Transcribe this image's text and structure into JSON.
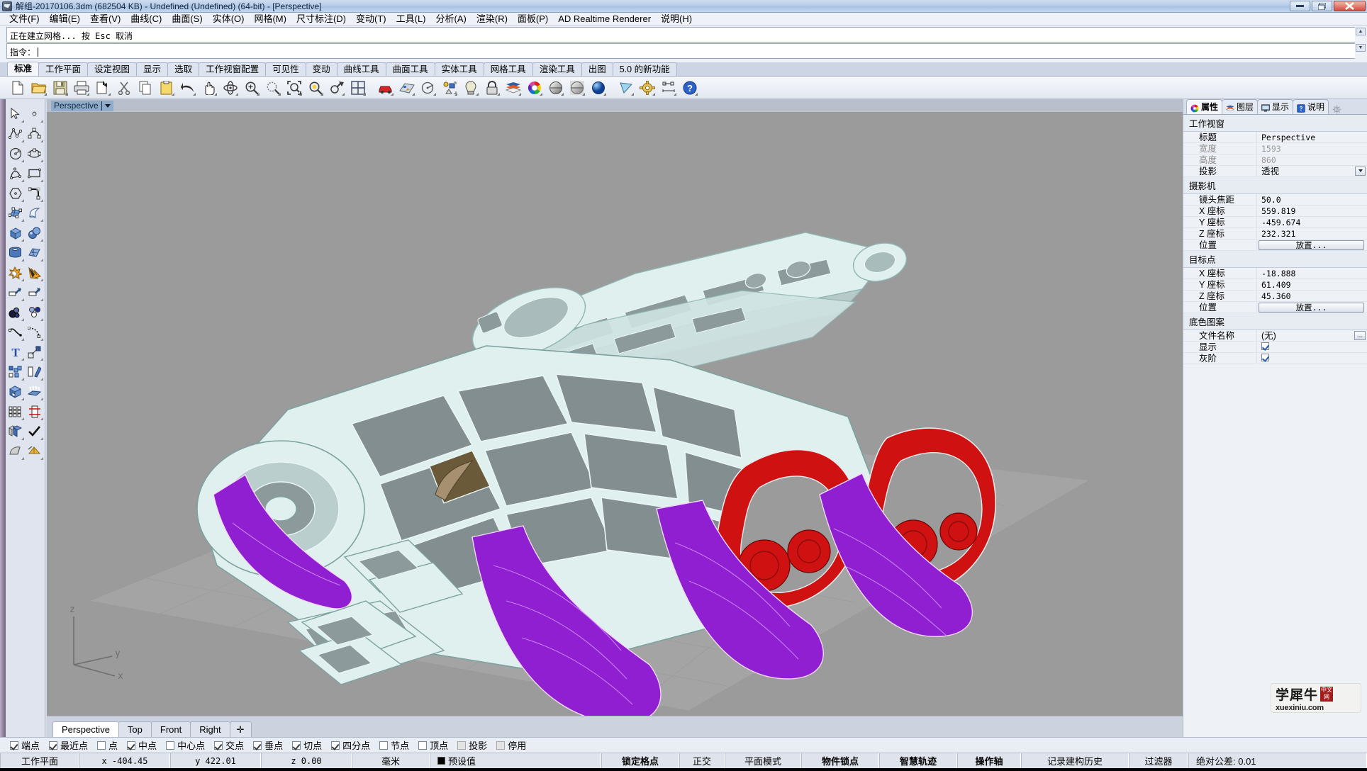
{
  "window": {
    "title": "解组-20170106.3dm (682504 KB) - Undefined (Undefined) (64-bit) - [Perspective]",
    "minimize": "—",
    "maximize": "❐",
    "close": "✕"
  },
  "menubar": {
    "items": [
      {
        "label": "文件(F)",
        "name": "menu-file"
      },
      {
        "label": "编辑(E)",
        "name": "menu-edit"
      },
      {
        "label": "查看(V)",
        "name": "menu-view"
      },
      {
        "label": "曲线(C)",
        "name": "menu-curve"
      },
      {
        "label": "曲面(S)",
        "name": "menu-surface"
      },
      {
        "label": "实体(O)",
        "name": "menu-solid"
      },
      {
        "label": "网格(M)",
        "name": "menu-mesh"
      },
      {
        "label": "尺寸标注(D)",
        "name": "menu-dimension"
      },
      {
        "label": "变动(T)",
        "name": "menu-transform"
      },
      {
        "label": "工具(L)",
        "name": "menu-tools"
      },
      {
        "label": "分析(A)",
        "name": "menu-analyze"
      },
      {
        "label": "渲染(R)",
        "name": "menu-render"
      },
      {
        "label": "面板(P)",
        "name": "menu-panels"
      },
      {
        "label": "AD Realtime Renderer",
        "name": "menu-ad-realtime-renderer"
      },
      {
        "label": "说明(H)",
        "name": "menu-help"
      }
    ]
  },
  "command": {
    "history": "正在建立网格... 按 Esc 取消",
    "prompt_label": "指令：",
    "prompt_value": ""
  },
  "ribbon": {
    "tabs": [
      {
        "label": "标准",
        "active": true
      },
      {
        "label": "工作平面",
        "active": false
      },
      {
        "label": "设定视图",
        "active": false
      },
      {
        "label": "显示",
        "active": false
      },
      {
        "label": "选取",
        "active": false
      },
      {
        "label": "工作视窗配置",
        "active": false
      },
      {
        "label": "可见性",
        "active": false
      },
      {
        "label": "变动",
        "active": false
      },
      {
        "label": "曲线工具",
        "active": false
      },
      {
        "label": "曲面工具",
        "active": false
      },
      {
        "label": "实体工具",
        "active": false
      },
      {
        "label": "网格工具",
        "active": false
      },
      {
        "label": "渲染工具",
        "active": false
      },
      {
        "label": "出图",
        "active": false
      },
      {
        "label": "5.0 的新功能",
        "active": false
      }
    ]
  },
  "toolbar": {
    "buttons": [
      {
        "icon": "new-file-icon",
        "name": "new-button"
      },
      {
        "icon": "open-folder-icon",
        "name": "open-button"
      },
      {
        "icon": "save-disk-icon",
        "name": "save-button"
      },
      {
        "icon": "printer-icon",
        "name": "print-button"
      },
      {
        "icon": "export-icon",
        "name": "export-button"
      },
      {
        "icon": "scissors-icon",
        "name": "cut-button"
      },
      {
        "icon": "copy-icon",
        "name": "copy-button"
      },
      {
        "icon": "clipboard-icon",
        "name": "paste-button"
      },
      {
        "icon": "undo-arrow-icon",
        "name": "undo-button"
      },
      {
        "icon": "pan-hand-icon",
        "name": "pan-button"
      },
      {
        "icon": "rotate-view-icon",
        "name": "rotate-view-button"
      },
      {
        "icon": "zoom-in-icon",
        "name": "zoom-in-button"
      },
      {
        "icon": "zoom-window-icon",
        "name": "zoom-window-button"
      },
      {
        "icon": "zoom-extents-icon",
        "name": "zoom-extents-button"
      },
      {
        "icon": "zoom-selected-icon",
        "name": "zoom-selected-button"
      },
      {
        "icon": "zoom-previous-icon",
        "name": "zoom-previous-button"
      },
      {
        "icon": "viewport-layout-icon",
        "name": "viewport-layout-button"
      },
      {
        "icon": "car-icon",
        "name": "named-views-button"
      },
      {
        "icon": "cplane-icon",
        "name": "cplane-button"
      },
      {
        "icon": "circle-radius-icon",
        "name": "analyze-button"
      },
      {
        "icon": "select-objects-icon",
        "name": "select-objects-button"
      },
      {
        "icon": "light-bulb-icon",
        "name": "lights-button"
      },
      {
        "icon": "lock-icon",
        "name": "lock-button"
      },
      {
        "icon": "layers-icon",
        "name": "layers-button"
      },
      {
        "icon": "color-wheel-icon",
        "name": "color-button"
      },
      {
        "icon": "shade-sphere-icon",
        "name": "shaded-display-button"
      },
      {
        "icon": "ghost-sphere-icon",
        "name": "ghosted-display-button"
      },
      {
        "icon": "render-sphere-icon",
        "name": "rendered-display-button"
      },
      {
        "icon": "flat-shade-icon",
        "name": "flat-shade-button"
      },
      {
        "icon": "gear-icon",
        "name": "options-button"
      },
      {
        "icon": "dimension-icon",
        "name": "dimension-button"
      },
      {
        "icon": "help-icon",
        "name": "help-button"
      }
    ]
  },
  "left_toolbar": {
    "buttons": [
      {
        "icon": "arrow-select-icon",
        "name": "select-tool"
      },
      {
        "icon": "point-icon",
        "name": "point-tool"
      },
      {
        "icon": "polyline-icon",
        "name": "polyline-tool"
      },
      {
        "icon": "control-point-curve-icon",
        "name": "curve-tool"
      },
      {
        "icon": "circle-icon",
        "name": "circle-tool"
      },
      {
        "icon": "ellipse-icon",
        "name": "ellipse-tool"
      },
      {
        "icon": "arc-icon",
        "name": "arc-tool"
      },
      {
        "icon": "rectangle-icon",
        "name": "rectangle-tool"
      },
      {
        "icon": "polygon-icon",
        "name": "polygon-tool"
      },
      {
        "icon": "curve-fillet-icon",
        "name": "fillet-curve-tool"
      },
      {
        "icon": "surface-from-points-icon",
        "name": "surface-tool"
      },
      {
        "icon": "loft-surface-icon",
        "name": "loft-tool"
      },
      {
        "icon": "box-icon",
        "name": "box-tool"
      },
      {
        "icon": "spheres-icon",
        "name": "sphere-tool"
      },
      {
        "icon": "cylinder-icon",
        "name": "cylinder-tool"
      },
      {
        "icon": "mesh-icon",
        "name": "mesh-tool"
      },
      {
        "icon": "boolean-union-icon",
        "name": "boolean-union-tool"
      },
      {
        "icon": "explode-icon",
        "name": "explode-tool"
      },
      {
        "icon": "trim-icon",
        "name": "trim-tool"
      },
      {
        "icon": "split-icon",
        "name": "split-tool"
      },
      {
        "icon": "fillet-edge-icon",
        "name": "fillet-edge-tool"
      },
      {
        "icon": "offset-icon",
        "name": "offset-tool"
      },
      {
        "icon": "blend-curve-icon",
        "name": "blend-curve-tool"
      },
      {
        "icon": "curve-extend-icon",
        "name": "extend-curve-tool"
      },
      {
        "icon": "text-icon",
        "name": "text-tool"
      },
      {
        "icon": "scale-icon",
        "name": "scale-tool"
      },
      {
        "icon": "array-icon",
        "name": "array-tool"
      },
      {
        "icon": "mirror-icon",
        "name": "mirror-tool"
      },
      {
        "icon": "cap-hole-icon",
        "name": "cap-tool"
      },
      {
        "icon": "extrude-icon",
        "name": "extrude-tool"
      },
      {
        "icon": "rectangular-array-icon",
        "name": "rectangular-array-tool"
      },
      {
        "icon": "section-icon",
        "name": "section-tool"
      },
      {
        "icon": "boolean-difference-icon",
        "name": "boolean-difference-tool"
      },
      {
        "icon": "check-icon",
        "name": "check-tool"
      },
      {
        "icon": "taper-icon",
        "name": "taper-tool"
      },
      {
        "icon": "render-tools-icon",
        "name": "render-tool"
      }
    ]
  },
  "viewport": {
    "title": "Perspective",
    "axis": {
      "x": "x",
      "y": "y",
      "z": "z"
    },
    "tabs": [
      {
        "label": "Perspective",
        "active": true
      },
      {
        "label": "Top",
        "active": false
      },
      {
        "label": "Front",
        "active": false
      },
      {
        "label": "Right",
        "active": false
      },
      {
        "label": "✛",
        "active": false
      }
    ],
    "colors": {
      "background": "#9b9b9b",
      "ground_plane": "#a3a3a3",
      "model_white": "#dff0ee",
      "model_gray": "#808b8d",
      "model_red": "#cf1111",
      "model_purple": "#8f1fd0"
    }
  },
  "properties_panel": {
    "tabs": [
      {
        "label": "属性",
        "icon": "color-wheel-icon",
        "active": true
      },
      {
        "label": "图层",
        "icon": "layers-icon",
        "active": false
      },
      {
        "label": "显示",
        "icon": "monitor-icon",
        "active": false
      },
      {
        "label": "说明",
        "icon": "help-icon",
        "active": false
      }
    ],
    "groups": [
      {
        "title": "工作视窗",
        "rows": [
          {
            "label": "标题",
            "value": "Perspective",
            "type": "text"
          },
          {
            "label": "宽度",
            "value": "1593",
            "type": "readonly"
          },
          {
            "label": "高度",
            "value": "860",
            "type": "readonly"
          },
          {
            "label": "投影",
            "value": "透视",
            "type": "dropdown"
          }
        ]
      },
      {
        "title": "摄影机",
        "rows": [
          {
            "label": "镜头焦距",
            "value": "50.0",
            "type": "text"
          },
          {
            "label": "X 座标",
            "value": "559.819",
            "type": "text"
          },
          {
            "label": "Y 座标",
            "value": "-459.674",
            "type": "text"
          },
          {
            "label": "Z 座标",
            "value": "232.321",
            "type": "text"
          },
          {
            "label": "位置",
            "value": "放置...",
            "type": "button"
          }
        ]
      },
      {
        "title": "目标点",
        "rows": [
          {
            "label": "X 座标",
            "value": "-18.888",
            "type": "text"
          },
          {
            "label": "Y 座标",
            "value": "61.409",
            "type": "text"
          },
          {
            "label": "Z 座标",
            "value": "45.360",
            "type": "text"
          },
          {
            "label": "位置",
            "value": "放置...",
            "type": "button"
          }
        ]
      },
      {
        "title": "底色图案",
        "rows": [
          {
            "label": "文件名称",
            "value": "(无)",
            "type": "file"
          },
          {
            "label": "显示",
            "value": "",
            "type": "checkbox",
            "checked": true
          },
          {
            "label": "灰阶",
            "value": "",
            "type": "checkbox",
            "checked": true
          }
        ]
      }
    ]
  },
  "osnap": {
    "items": [
      {
        "label": "端点",
        "checked": true,
        "enabled": true
      },
      {
        "label": "最近点",
        "checked": true,
        "enabled": true
      },
      {
        "label": "点",
        "checked": false,
        "enabled": true
      },
      {
        "label": "中点",
        "checked": true,
        "enabled": true
      },
      {
        "label": "中心点",
        "checked": false,
        "enabled": true
      },
      {
        "label": "交点",
        "checked": true,
        "enabled": true
      },
      {
        "label": "垂点",
        "checked": true,
        "enabled": true
      },
      {
        "label": "切点",
        "checked": true,
        "enabled": true
      },
      {
        "label": "四分点",
        "checked": true,
        "enabled": true
      },
      {
        "label": "节点",
        "checked": false,
        "enabled": true
      },
      {
        "label": "顶点",
        "checked": false,
        "enabled": true
      },
      {
        "label": "投影",
        "checked": false,
        "enabled": false
      },
      {
        "label": "停用",
        "checked": false,
        "enabled": false
      }
    ]
  },
  "statusbar": {
    "cplane_label": "工作平面",
    "x": "x -404.45",
    "y": "y 422.01",
    "z": "z 0.00",
    "units": "毫米",
    "layer": "预设值",
    "layer_color": "#000000",
    "toggles": [
      {
        "label": "锁定格点",
        "on": true
      },
      {
        "label": "正交",
        "on": false
      },
      {
        "label": "平面模式",
        "on": false
      },
      {
        "label": "物件锁点",
        "on": true
      },
      {
        "label": "智慧轨迹",
        "on": true
      },
      {
        "label": "操作轴",
        "on": true
      },
      {
        "label": "记录建构历史",
        "on": false
      },
      {
        "label": "过滤器",
        "on": false
      }
    ],
    "tolerance": "绝对公差: 0.01"
  },
  "watermark": {
    "brand": "学犀牛",
    "badge_top": "中文",
    "badge_bottom": "网",
    "url": "xuexiniu.com"
  }
}
